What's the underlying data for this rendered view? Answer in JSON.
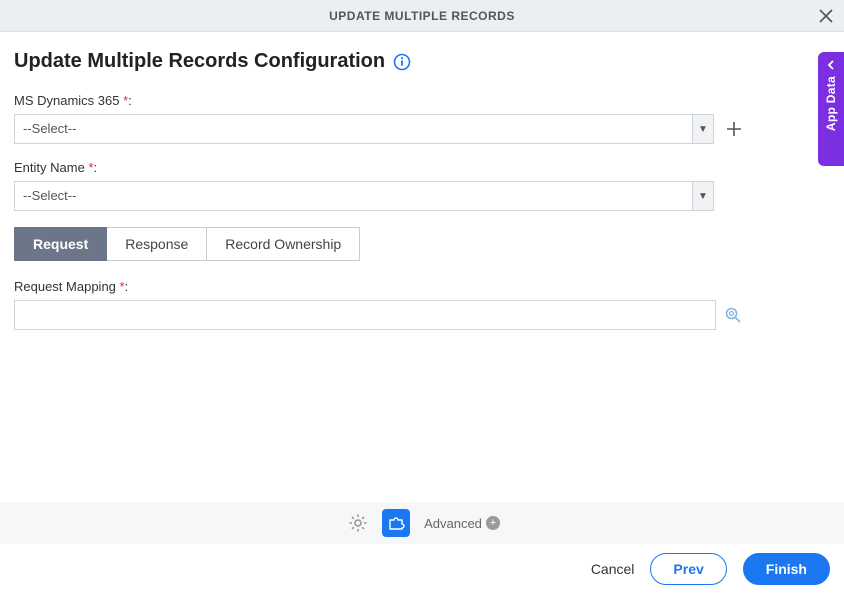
{
  "header": {
    "title": "UPDATE MULTIPLE RECORDS"
  },
  "page": {
    "title": "Update Multiple Records Configuration"
  },
  "fields": {
    "dynamics": {
      "label": "MS Dynamics 365",
      "placeholder": "--Select--"
    },
    "entity": {
      "label": "Entity Name",
      "placeholder": "--Select--"
    },
    "mapping": {
      "label": "Request Mapping",
      "value": ""
    }
  },
  "tabs": {
    "request": "Request",
    "response": "Response",
    "ownership": "Record Ownership",
    "active": "request"
  },
  "bottom": {
    "advanced": "Advanced"
  },
  "footer": {
    "cancel": "Cancel",
    "prev": "Prev",
    "finish": "Finish"
  },
  "side": {
    "label": "App Data"
  }
}
